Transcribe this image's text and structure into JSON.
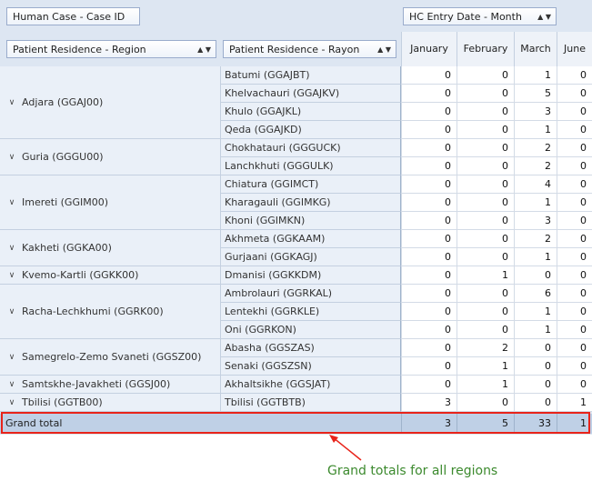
{
  "fields": {
    "data_field": "Human Case - Case ID",
    "column_field": "HC Entry Date - Month",
    "row_field_region": "Patient Residence - Region",
    "row_field_rayon": "Patient Residence - Rayon",
    "sort_glyph": "▲",
    "filter_glyph": "▼"
  },
  "months": [
    "January",
    "February",
    "March",
    "June"
  ],
  "regions": [
    {
      "label": "Adjara (GGAJ00)",
      "rayons": [
        {
          "label": "Batumi (GGAJBT)",
          "values": [
            "0",
            "0",
            "1",
            "0"
          ]
        },
        {
          "label": "Khelvachauri (GGAJKV)",
          "values": [
            "0",
            "0",
            "5",
            "0"
          ]
        },
        {
          "label": "Khulo (GGAJKL)",
          "values": [
            "0",
            "0",
            "3",
            "0"
          ]
        },
        {
          "label": "Qeda (GGAJKD)",
          "values": [
            "0",
            "0",
            "1",
            "0"
          ]
        }
      ]
    },
    {
      "label": "Guria (GGGU00)",
      "rayons": [
        {
          "label": "Chokhatauri (GGGUCK)",
          "values": [
            "0",
            "0",
            "2",
            "0"
          ]
        },
        {
          "label": "Lanchkhuti (GGGULK)",
          "values": [
            "0",
            "0",
            "2",
            "0"
          ]
        }
      ]
    },
    {
      "label": "Imereti (GGIM00)",
      "rayons": [
        {
          "label": "Chiatura (GGIMCT)",
          "values": [
            "0",
            "0",
            "4",
            "0"
          ]
        },
        {
          "label": "Kharagauli (GGIMKG)",
          "values": [
            "0",
            "0",
            "1",
            "0"
          ]
        },
        {
          "label": "Khoni (GGIMKN)",
          "values": [
            "0",
            "0",
            "3",
            "0"
          ]
        }
      ]
    },
    {
      "label": "Kakheti (GGKA00)",
      "rayons": [
        {
          "label": "Akhmeta (GGKAAM)",
          "values": [
            "0",
            "0",
            "2",
            "0"
          ]
        },
        {
          "label": "Gurjaani (GGKAGJ)",
          "values": [
            "0",
            "0",
            "1",
            "0"
          ]
        }
      ]
    },
    {
      "label": "Kvemo-Kartli (GGKK00)",
      "rayons": [
        {
          "label": "Dmanisi (GGKKDM)",
          "values": [
            "0",
            "1",
            "0",
            "0"
          ]
        }
      ]
    },
    {
      "label": "Racha-Lechkhumi (GGRK00)",
      "rayons": [
        {
          "label": "Ambrolauri (GGRKAL)",
          "values": [
            "0",
            "0",
            "6",
            "0"
          ]
        },
        {
          "label": "Lentekhi (GGRKLE)",
          "values": [
            "0",
            "0",
            "1",
            "0"
          ]
        },
        {
          "label": "Oni (GGRKON)",
          "values": [
            "0",
            "0",
            "1",
            "0"
          ]
        }
      ]
    },
    {
      "label": "Samegrelo-Zemo Svaneti (GGSZ00)",
      "rayons": [
        {
          "label": "Abasha (GGSZAS)",
          "values": [
            "0",
            "2",
            "0",
            "0"
          ]
        },
        {
          "label": "Senaki (GGSZSN)",
          "values": [
            "0",
            "1",
            "0",
            "0"
          ]
        }
      ]
    },
    {
      "label": "Samtskhe-Javakheti (GGSJ00)",
      "rayons": [
        {
          "label": "Akhaltsikhe (GGSJAT)",
          "values": [
            "0",
            "1",
            "0",
            "0"
          ]
        }
      ]
    },
    {
      "label": "Tbilisi (GGTB00)",
      "rayons": [
        {
          "label": "Tbilisi (GGTBTB)",
          "values": [
            "3",
            "0",
            "0",
            "1"
          ]
        }
      ]
    }
  ],
  "grand_total": {
    "label": "Grand total",
    "values": [
      "3",
      "5",
      "33",
      "1"
    ]
  },
  "annotation": {
    "caption": "Grand totals for all regions",
    "color": "#e8231a",
    "caption_color": "#3c8a2e"
  }
}
